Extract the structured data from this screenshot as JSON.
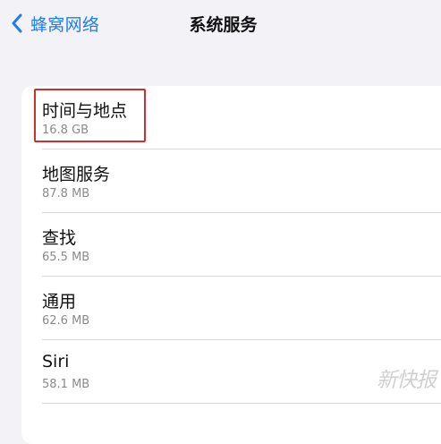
{
  "nav": {
    "back_label": "蜂窝网络",
    "title": "系统服务"
  },
  "items": [
    {
      "title": "时间与地点",
      "size": "16.8 GB"
    },
    {
      "title": "地图服务",
      "size": "87.8 MB"
    },
    {
      "title": "查找",
      "size": "65.5 MB"
    },
    {
      "title": "通用",
      "size": "62.6 MB"
    },
    {
      "title": "Siri",
      "size": "58.1 MB"
    }
  ],
  "watermark": "新快报",
  "colors": {
    "accent": "#1f7cf5",
    "highlight": "#d12f2f",
    "background": "#f2f2f7"
  },
  "icons": {
    "back": "chevron-left-icon"
  }
}
